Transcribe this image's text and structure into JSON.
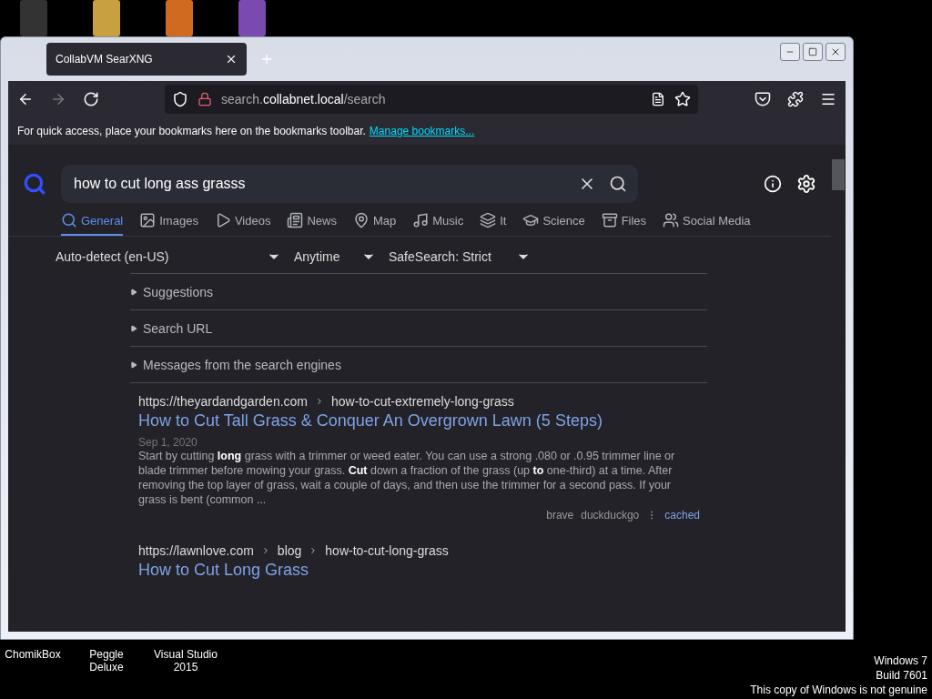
{
  "browser": {
    "tab_title": "CollabVM SearXNG",
    "address": {
      "host_prefix": "search.",
      "host": "collabnet.local",
      "path": "/search"
    },
    "bookmarks_hint": "For quick access, place your bookmarks here on the bookmarks toolbar.",
    "bookmarks_link": "Manage bookmarks..."
  },
  "search": {
    "query": "how to cut long ass grasss"
  },
  "categories": [
    {
      "label": "General",
      "kind": "search",
      "selected": true
    },
    {
      "label": "Images",
      "kind": "image",
      "selected": false
    },
    {
      "label": "Videos",
      "kind": "video",
      "selected": false
    },
    {
      "label": "News",
      "kind": "news",
      "selected": false
    },
    {
      "label": "Map",
      "kind": "map",
      "selected": false
    },
    {
      "label": "Music",
      "kind": "music",
      "selected": false
    },
    {
      "label": "It",
      "kind": "layers",
      "selected": false
    },
    {
      "label": "Science",
      "kind": "science",
      "selected": false
    },
    {
      "label": "Files",
      "kind": "files",
      "selected": false
    },
    {
      "label": "Social Media",
      "kind": "social",
      "selected": false
    }
  ],
  "filters": [
    {
      "value": "Auto-detect (en-US)"
    },
    {
      "value": "Anytime"
    },
    {
      "value": "SafeSearch: Strict"
    }
  ],
  "sections": [
    {
      "label": "Suggestions",
      "expanded": false
    },
    {
      "label": "Search URL",
      "expanded": false
    },
    {
      "label": "Messages from the search engines",
      "expanded": false
    }
  ],
  "results": [
    {
      "url": "https://theyardandgarden.com",
      "path": [
        "how-to-cut-extremely-long-grass"
      ],
      "title": "How to Cut Tall Grass & Conquer An Overgrown Lawn (5 Steps)",
      "date": "Sep 1, 2020",
      "snippet": "Start by cutting **long** grass with a trimmer or weed eater. You can use a strong .080 or .0.95 trimmer line or blade trimmer before mowing your grass. **Cut** down a fraction of the grass (up **to** one-third) at a time. After removing the top layer of grass, wait a couple of days, and then use the trimmer for a second pass. If your grass is bent (common ...",
      "engines": [
        "brave",
        "duckduckgo"
      ],
      "cached": "cached"
    },
    {
      "url": "https://lawnlove.com",
      "path": [
        "blog",
        "how-to-cut-long-grass"
      ],
      "title": "How to Cut Long Grass"
    }
  ],
  "desktop": {
    "icons": [
      "ChomikBox",
      "Peggle Deluxe",
      "Visual Studio 2015"
    ],
    "notice": [
      "Windows 7",
      "Build 7601",
      "This copy of Windows is not genuine"
    ]
  }
}
